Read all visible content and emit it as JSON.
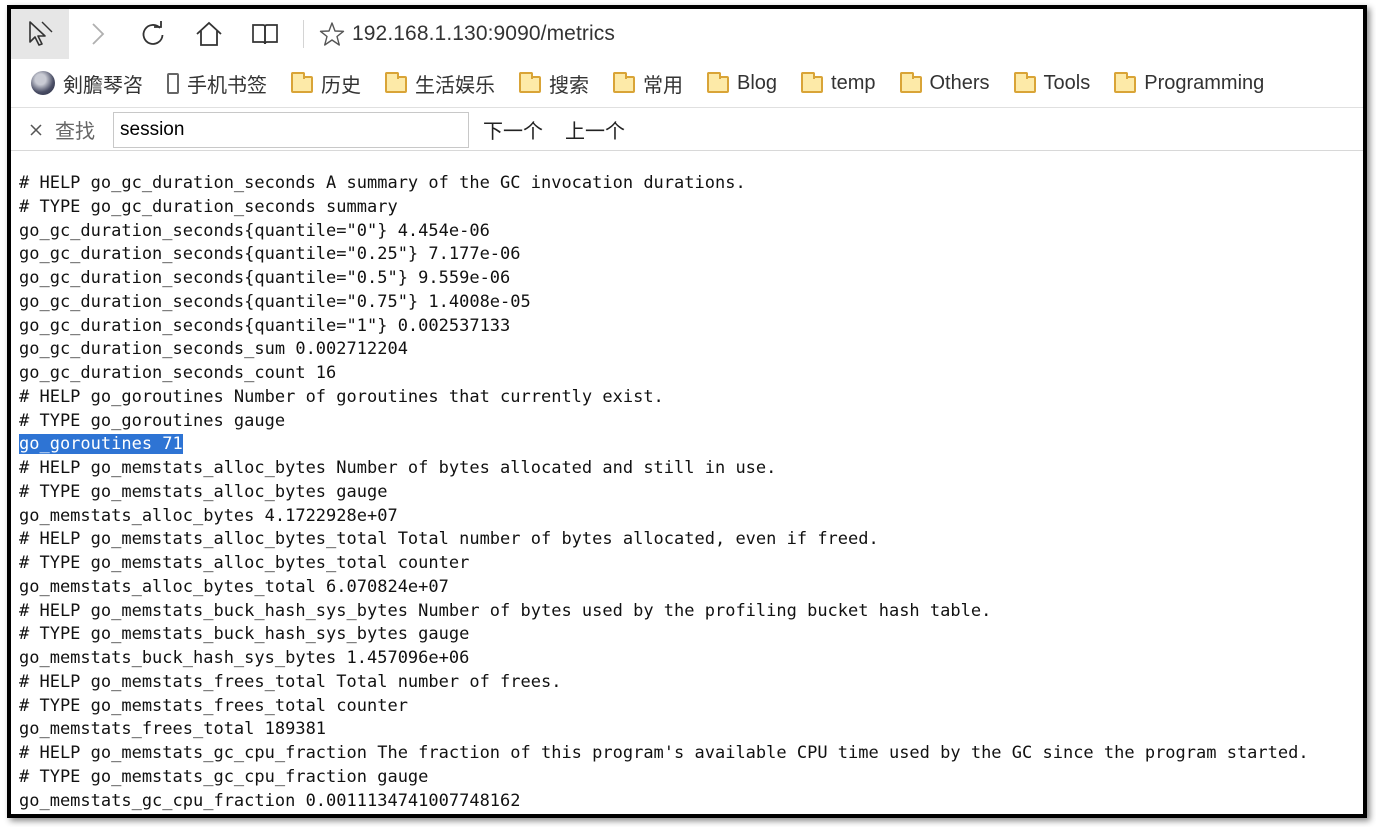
{
  "browser": {
    "url": "192.168.1.130:9090/metrics",
    "icons": [
      "cursor-select-icon",
      "forward-icon",
      "refresh-icon",
      "home-icon",
      "reading-view-icon",
      "favorite-star-icon"
    ]
  },
  "bookmarks": [
    {
      "label": "剣膽琴咨",
      "icon": "avatar"
    },
    {
      "label": "手机书签",
      "icon": "phone"
    },
    {
      "label": "历史",
      "icon": "folder"
    },
    {
      "label": "生活娱乐",
      "icon": "folder"
    },
    {
      "label": "搜索",
      "icon": "folder"
    },
    {
      "label": "常用",
      "icon": "folder"
    },
    {
      "label": "Blog",
      "icon": "folder"
    },
    {
      "label": "temp",
      "icon": "folder"
    },
    {
      "label": "Others",
      "icon": "folder"
    },
    {
      "label": "Tools",
      "icon": "folder"
    },
    {
      "label": "Programming",
      "icon": "folder"
    }
  ],
  "findbar": {
    "label": "查找",
    "query": "session",
    "next": "下一个",
    "prev": "上一个"
  },
  "metrics_lines": [
    "# HELP go_gc_duration_seconds A summary of the GC invocation durations.",
    "# TYPE go_gc_duration_seconds summary",
    "go_gc_duration_seconds{quantile=\"0\"} 4.454e-06",
    "go_gc_duration_seconds{quantile=\"0.25\"} 7.177e-06",
    "go_gc_duration_seconds{quantile=\"0.5\"} 9.559e-06",
    "go_gc_duration_seconds{quantile=\"0.75\"} 1.4008e-05",
    "go_gc_duration_seconds{quantile=\"1\"} 0.002537133",
    "go_gc_duration_seconds_sum 0.002712204",
    "go_gc_duration_seconds_count 16",
    "# HELP go_goroutines Number of goroutines that currently exist.",
    "# TYPE go_goroutines gauge",
    "go_goroutines 71",
    "# HELP go_memstats_alloc_bytes Number of bytes allocated and still in use.",
    "# TYPE go_memstats_alloc_bytes gauge",
    "go_memstats_alloc_bytes 4.1722928e+07",
    "# HELP go_memstats_alloc_bytes_total Total number of bytes allocated, even if freed.",
    "# TYPE go_memstats_alloc_bytes_total counter",
    "go_memstats_alloc_bytes_total 6.070824e+07",
    "# HELP go_memstats_buck_hash_sys_bytes Number of bytes used by the profiling bucket hash table.",
    "# TYPE go_memstats_buck_hash_sys_bytes gauge",
    "go_memstats_buck_hash_sys_bytes 1.457096e+06",
    "# HELP go_memstats_frees_total Total number of frees.",
    "# TYPE go_memstats_frees_total counter",
    "go_memstats_frees_total 189381",
    "# HELP go_memstats_gc_cpu_fraction The fraction of this program's available CPU time used by the GC since the program started.",
    "# TYPE go_memstats_gc_cpu_fraction gauge",
    "go_memstats_gc_cpu_fraction 0.0011134741007748162"
  ],
  "selected_line": "go_goroutines 71",
  "colors": {
    "selection": "#2e74d4",
    "folder": "#fdeaa8"
  }
}
